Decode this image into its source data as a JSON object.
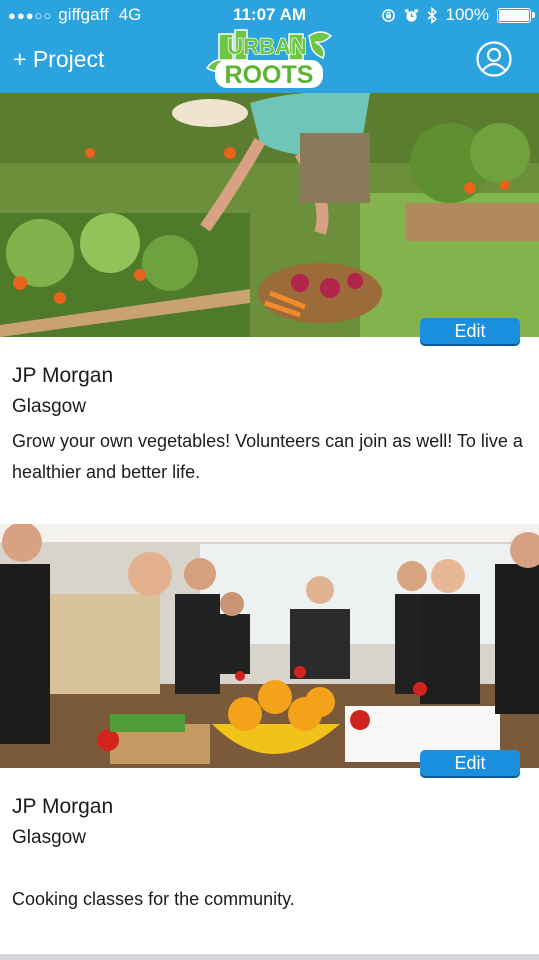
{
  "status_bar": {
    "carrier": "giffgaff",
    "network": "4G",
    "time": "11:07 AM",
    "battery_percent": "100%",
    "battery_level": 1.0,
    "icons": [
      "signal-dots-icon",
      "rotation-lock-icon",
      "alarm-icon",
      "bluetooth-icon",
      "battery-icon"
    ]
  },
  "header": {
    "add_project_label": "+ Project",
    "logo_top_text": "URBAN",
    "logo_bottom_text": "ROOTS",
    "profile_icon": "user-icon",
    "color": "#2aa3de"
  },
  "projects": [
    {
      "image": "vegetable-garden-photo",
      "edit_label": "Edit",
      "name": "JP Morgan",
      "location": "Glasgow",
      "description": "Grow your own vegetables! Volunteers can join as well! To live a healthier and better life."
    },
    {
      "image": "cooking-class-photo",
      "edit_label": "Edit",
      "name": "JP Morgan",
      "location": "Glasgow",
      "description": "Cooking classes for the community."
    }
  ],
  "colors": {
    "edit_button": "#1a8fe0",
    "header": "#2aa3de"
  }
}
